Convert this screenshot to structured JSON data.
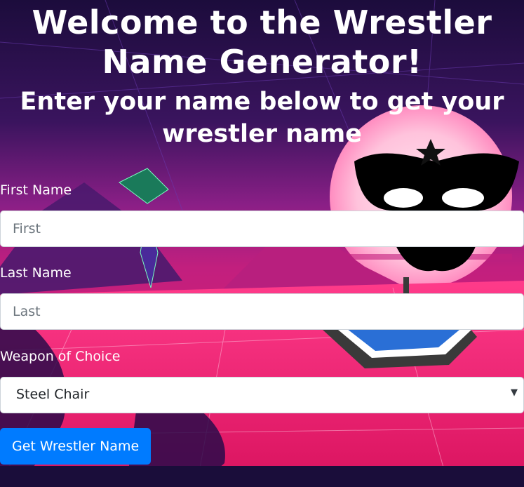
{
  "header": {
    "title": "Welcome to the Wrestler Name Generator!",
    "subtitle": "Enter your name below to get your wrestler name"
  },
  "form": {
    "first_name": {
      "label": "First Name",
      "placeholder": "First",
      "value": ""
    },
    "last_name": {
      "label": "Last Name",
      "placeholder": "Last",
      "value": ""
    },
    "weapon": {
      "label": "Weapon of Choice",
      "selected": "Steel Chair"
    },
    "submit_label": "Get Wrestler Name"
  },
  "colors": {
    "button": "#007bff",
    "sky_top": "#1a0d3a",
    "sky_mid": "#6a1a7a",
    "floor": "#f0286f"
  },
  "icons": {
    "select_arrow": "caret-down-icon"
  }
}
